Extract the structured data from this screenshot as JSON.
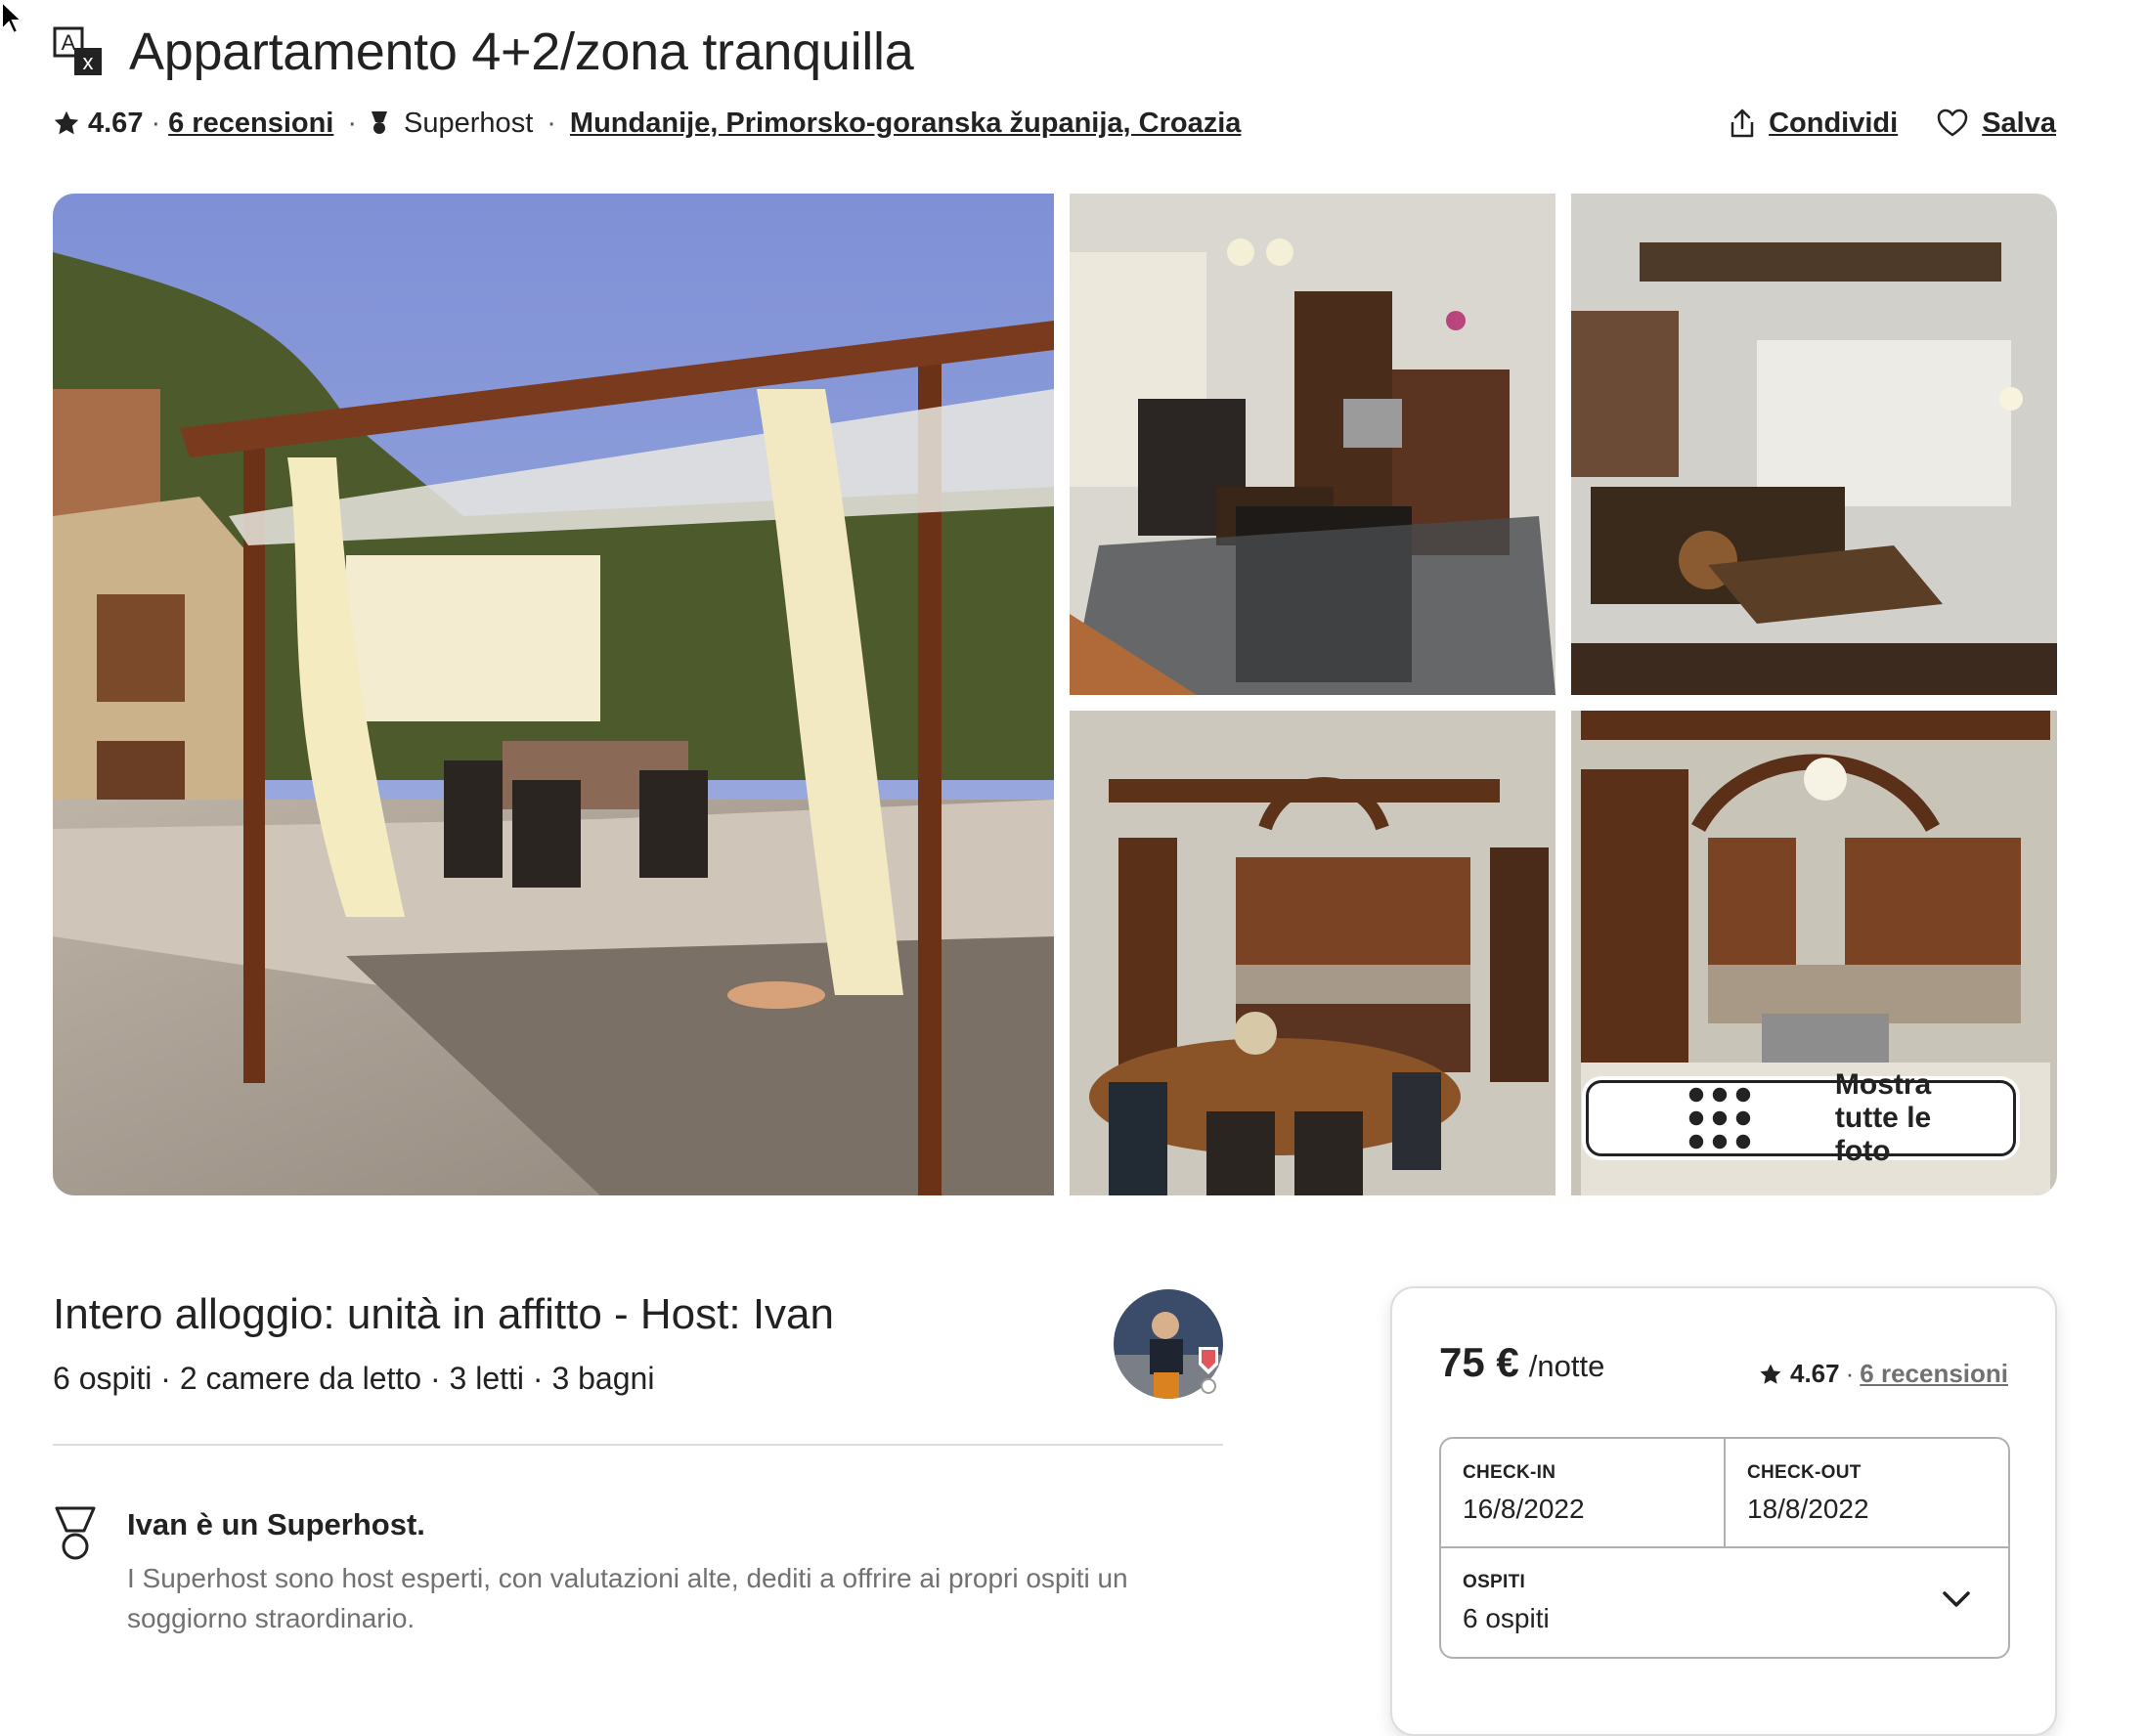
{
  "header": {
    "title": "Appartamento 4+2/zona tranquilla",
    "rating": "4.67",
    "reviews_label": "6 recensioni",
    "superhost_label": "Superhost",
    "location": "Mundanije, Primorsko-goranska županija, Croazia",
    "share_label": "Condividi",
    "save_label": "Salva",
    "sep": "·"
  },
  "gallery": {
    "show_all_label": "Mostra tutte le foto"
  },
  "listing": {
    "title": "Intero alloggio: unità in affitto - Host: Ivan",
    "details": "6 ospiti · 2 camere da letto · 3 letti · 3 bagni",
    "superhost_title": "Ivan è un Superhost.",
    "superhost_desc": "I Superhost sono host esperti, con valutazioni alte, dediti a offrire ai propri ospiti un soggiorno straordinario."
  },
  "booking": {
    "price": "75 €",
    "per_night": "/notte",
    "rating": "4.67",
    "reviews_label": "6 recensioni",
    "sep": "·",
    "checkin_label": "CHECK-IN",
    "checkin_value": "16/8/2022",
    "checkout_label": "CHECK-OUT",
    "checkout_value": "18/8/2022",
    "guests_label": "OSPITI",
    "guests_value": "6 ospiti"
  },
  "icons": {
    "translate": "translate-icon",
    "star": "star-icon",
    "medal": "superhost-medal-icon",
    "share": "share-icon",
    "heart": "heart-icon",
    "grid": "grid-dots-icon",
    "chevron": "chevron-down-icon"
  },
  "colors": {
    "text": "#222222",
    "muted": "#717171",
    "border": "#dddddd",
    "input_border": "#b0b0b0"
  }
}
